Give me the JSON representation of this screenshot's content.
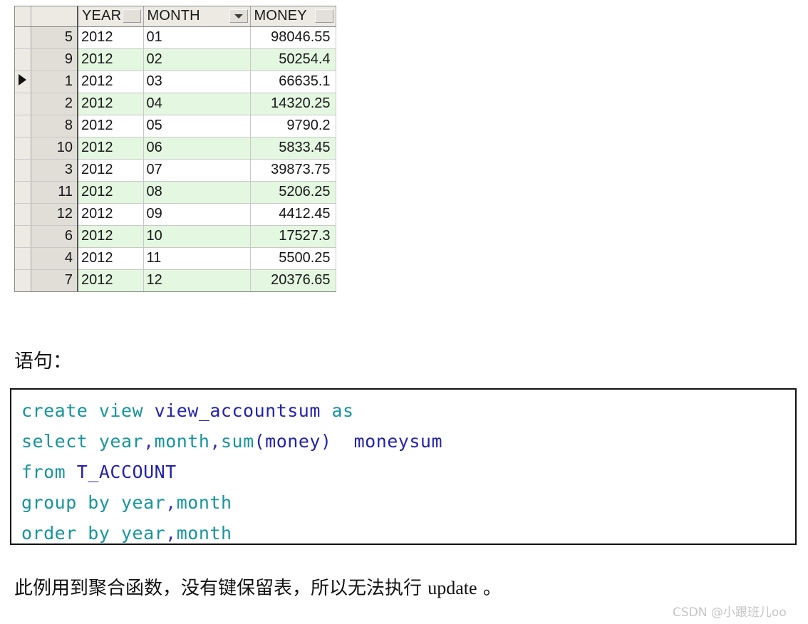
{
  "grid": {
    "columns": [
      {
        "key": "indicator",
        "label": "",
        "control": "none"
      },
      {
        "key": "rownum",
        "label": "",
        "control": "none"
      },
      {
        "key": "year",
        "label": "YEAR",
        "control": "grip"
      },
      {
        "key": "month",
        "label": "MONTH",
        "control": "dropdown"
      },
      {
        "key": "money",
        "label": "MONEY",
        "control": "grip"
      }
    ],
    "dropdown_icon": "filter-dropdown-arrow",
    "current_row_marker": "▶",
    "selected_row_index": 2,
    "rows": [
      {
        "rownum": "5",
        "year": "2012",
        "month": "01",
        "money": "98046.55"
      },
      {
        "rownum": "9",
        "year": "2012",
        "month": "02",
        "money": "50254.4"
      },
      {
        "rownum": "1",
        "year": "2012",
        "month": "03",
        "money": "66635.1"
      },
      {
        "rownum": "2",
        "year": "2012",
        "month": "04",
        "money": "14320.25"
      },
      {
        "rownum": "8",
        "year": "2012",
        "month": "05",
        "money": "9790.2"
      },
      {
        "rownum": "10",
        "year": "2012",
        "month": "06",
        "money": "5833.45"
      },
      {
        "rownum": "3",
        "year": "2012",
        "month": "07",
        "money": "39873.75"
      },
      {
        "rownum": "11",
        "year": "2012",
        "month": "08",
        "money": "5206.25"
      },
      {
        "rownum": "12",
        "year": "2012",
        "month": "09",
        "money": "4412.45"
      },
      {
        "rownum": "6",
        "year": "2012",
        "month": "10",
        "money": "17527.3"
      },
      {
        "rownum": "4",
        "year": "2012",
        "month": "11",
        "money": "5500.25"
      },
      {
        "rownum": "7",
        "year": "2012",
        "month": "12",
        "money": "20376.65"
      }
    ],
    "colors": {
      "header_bg": "#eceae3",
      "rownum_bg": "#e0ded6",
      "alt_row_bg": "#e4f7e0",
      "row_bg": "#ffffff",
      "gridline": "#c8c8c8"
    }
  },
  "labels": {
    "statement": "语句：",
    "note_cn_before": "此例用到聚合函数，没有键保留表，所以无法执行 ",
    "note_en": "update",
    "note_cn_after": " 。"
  },
  "code": {
    "language": "sql",
    "colors": {
      "keyword": "#16959b",
      "identifier": "#2323ae",
      "punctuation": "#3a2fb0"
    },
    "lines": [
      [
        {
          "t": "create view ",
          "c": "kw"
        },
        {
          "t": "view_accountsum",
          "c": "id"
        },
        {
          "t": " as",
          "c": "kw"
        }
      ],
      [
        {
          "t": "select year",
          "c": "kw"
        },
        {
          "t": ",",
          "c": "pn"
        },
        {
          "t": "month",
          "c": "kw"
        },
        {
          "t": ",",
          "c": "pn"
        },
        {
          "t": "sum",
          "c": "kw"
        },
        {
          "t": "(money)",
          "c": "id"
        },
        {
          "t": "  ",
          "c": "id"
        },
        {
          "t": "moneysum",
          "c": "id"
        }
      ],
      [
        {
          "t": "from ",
          "c": "kw"
        },
        {
          "t": "T_ACCOUNT",
          "c": "id"
        }
      ],
      [
        {
          "t": "group by year",
          "c": "kw"
        },
        {
          "t": ",",
          "c": "pn"
        },
        {
          "t": "month",
          "c": "kw"
        }
      ],
      [
        {
          "t": "order by year",
          "c": "kw"
        },
        {
          "t": ",",
          "c": "pn"
        },
        {
          "t": "month",
          "c": "kw"
        }
      ]
    ]
  },
  "watermark": {
    "text": "CSDN @小跟班儿oo"
  }
}
